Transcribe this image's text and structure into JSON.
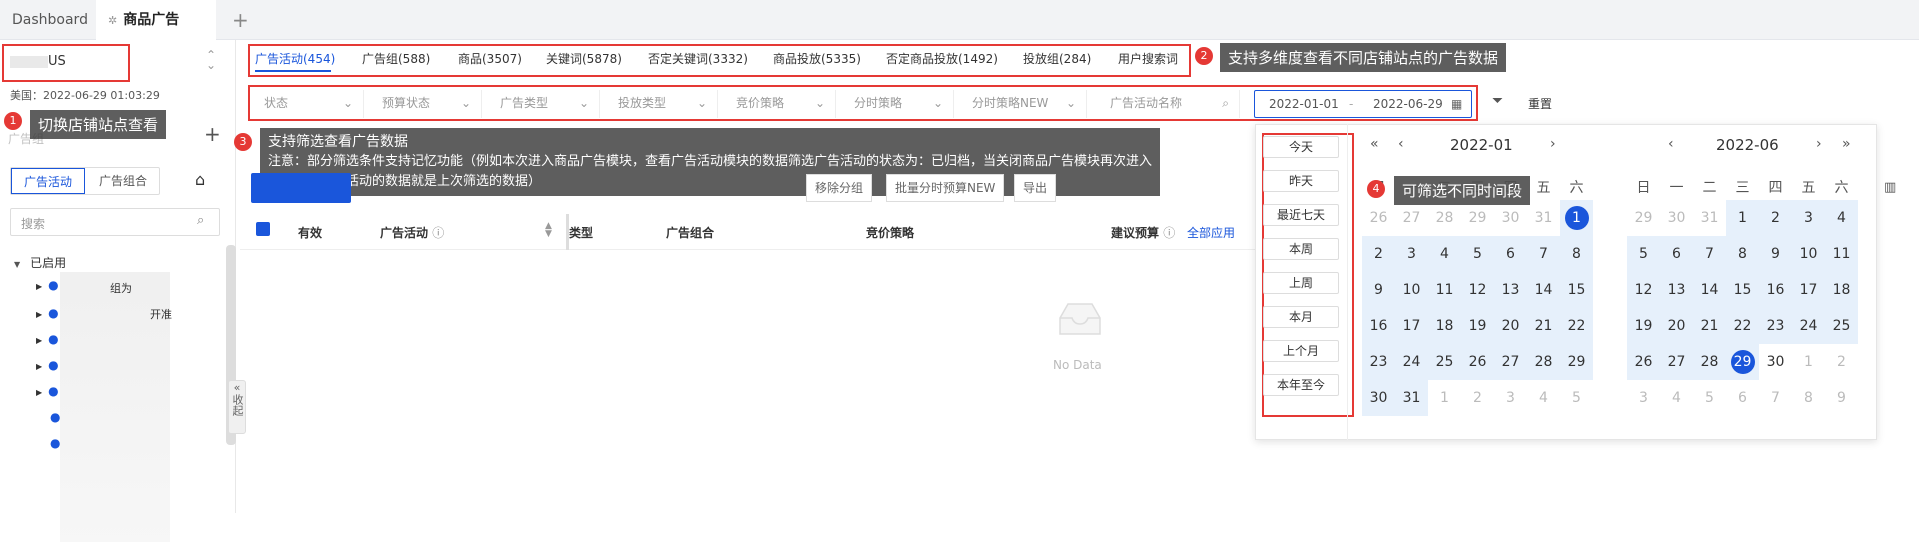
{
  "top_tabs": [
    {
      "label": "Dashboard",
      "active": false
    },
    {
      "label": "商品广告",
      "active": true
    }
  ],
  "sidebar": {
    "store_select_value": "US",
    "timestamp": "美国：2022-06-29 01:03:29",
    "section_title": "广告组",
    "toggle_tabs": [
      "广告活动",
      "广告组合"
    ],
    "search_placeholder": "搜索",
    "tree_root": "已启用",
    "collapse_label": "收起",
    "partial_items": [
      "组为",
      "开准"
    ]
  },
  "dimension_tabs": [
    "广告活动(454)",
    "广告组(588)",
    "商品(3507)",
    "关键词(5878)",
    "否定关键词(3332)",
    "商品投放(5335)",
    "否定商品投放(1492)",
    "投放组(284)",
    "用户搜索词"
  ],
  "filters": {
    "dropdowns": [
      "状态",
      "预算状态",
      "广告类型",
      "投放类型",
      "竞价策略",
      "分时策略",
      "分时策略NEW"
    ],
    "name_placeholder": "广告活动名称",
    "date_start": "2022-01-01",
    "date_sep": "-",
    "date_end": "2022-06-29",
    "reset_label": "重置"
  },
  "actions": {
    "buttons": [
      "移除分组",
      "批量分时预算NEW",
      "导出"
    ]
  },
  "table": {
    "headers": [
      "有效",
      "广告活动",
      "类型",
      "广告组合",
      "竞价策略",
      "建议预算",
      "全部应用"
    ],
    "empty_text": "No Data"
  },
  "calendar": {
    "quick_ranges": [
      "今天",
      "昨天",
      "最近七天",
      "本周",
      "上周",
      "本月",
      "上个月",
      "本年至今"
    ],
    "weekdays": [
      "日",
      "一",
      "二",
      "三",
      "四",
      "五",
      "六"
    ],
    "left": {
      "title": "2022-01",
      "days": [
        [
          "26",
          "27",
          "28",
          "29",
          "30",
          "31",
          "1"
        ],
        [
          "2",
          "3",
          "4",
          "5",
          "6",
          "7",
          "8"
        ],
        [
          "9",
          "10",
          "11",
          "12",
          "13",
          "14",
          "15"
        ],
        [
          "16",
          "17",
          "18",
          "19",
          "20",
          "21",
          "22"
        ],
        [
          "23",
          "24",
          "25",
          "26",
          "27",
          "28",
          "29"
        ],
        [
          "30",
          "31",
          "1",
          "2",
          "3",
          "4",
          "5"
        ]
      ]
    },
    "right": {
      "title": "2022-06",
      "days": [
        [
          "29",
          "30",
          "31",
          "1",
          "2",
          "3",
          "4"
        ],
        [
          "5",
          "6",
          "7",
          "8",
          "9",
          "10",
          "11"
        ],
        [
          "12",
          "13",
          "14",
          "15",
          "16",
          "17",
          "18"
        ],
        [
          "19",
          "20",
          "21",
          "22",
          "23",
          "24",
          "25"
        ],
        [
          "26",
          "27",
          "28",
          "29",
          "30",
          "1",
          "2"
        ],
        [
          "3",
          "4",
          "5",
          "6",
          "7",
          "8",
          "9"
        ]
      ]
    }
  },
  "callouts": [
    {
      "num": "1",
      "text": "切换店铺站点查看"
    },
    {
      "num": "2",
      "text": "支持多维度查看不同店铺站点的广告数据"
    },
    {
      "num": "3",
      "text": "支持筛选查看广告数据",
      "note": "注意：部分筛选条件支持记忆功能（例如本次进入商品广告模块，查看广告活动模块的数据筛选广告活动的状态为：已归档，当关闭商品广告模块再次进入时，查看广告活动的数据就是上次筛选的数据）"
    },
    {
      "num": "4",
      "text": "可筛选不同时间段"
    }
  ],
  "colors": {
    "accent": "#1a56db",
    "callout_red": "#e53935",
    "range_bg": "#e6f0fb"
  }
}
